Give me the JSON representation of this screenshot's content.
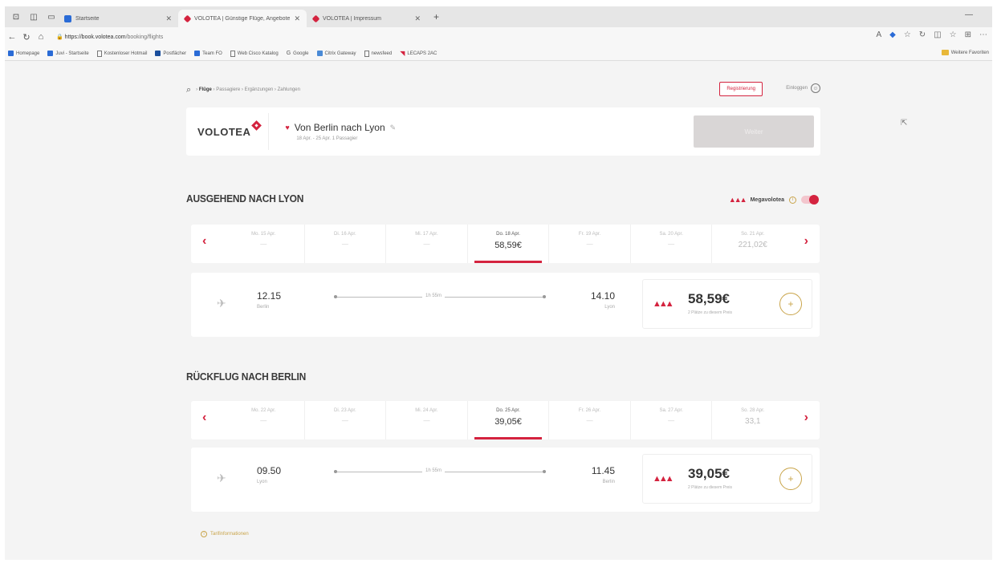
{
  "browser": {
    "tabs": [
      {
        "title": "Startseite",
        "active": false
      },
      {
        "title": "VOLOTEA | Günstige Flüge, Angebote",
        "active": true
      },
      {
        "title": "VOLOTEA | Impressum",
        "active": false
      }
    ],
    "url_host": "https://book.volotea.com",
    "url_path": "/booking/flights",
    "bookmarks": [
      "Homepage",
      "Juvi - Startseite",
      "Kostenloser Hotmail",
      "Postfächer",
      "Team FO",
      "Web Cisco Katalog",
      "Google",
      "Citrix Gateway",
      "newsfeed",
      "LECAPS 2AC"
    ],
    "bookmarks_more": "Weitere Favoriten"
  },
  "topnav": {
    "crumbs": [
      "Flüge",
      "Passagiere",
      "Ergänzungen",
      "Zahlungen"
    ],
    "register": "Registrierung",
    "login": "Einloggen"
  },
  "header": {
    "logo": "VOLOTEA",
    "route": "Von Berlin nach Lyon",
    "route_sub": "18 Apr. - 25 Apr. 1 Passagier",
    "continue": "Weiter"
  },
  "outbound": {
    "title": "AUSGEHEND NACH LYON",
    "megavolotea": "Megavolotea",
    "dates": [
      {
        "label": "Mo. 15 Apr.",
        "price": "—"
      },
      {
        "label": "Di. 16 Apr.",
        "price": "—"
      },
      {
        "label": "Mi. 17 Apr.",
        "price": "—"
      },
      {
        "label": "Do. 18 Apr.",
        "price": "58,59€",
        "selected": true
      },
      {
        "label": "Fr. 19 Apr.",
        "price": "—"
      },
      {
        "label": "Sa. 20 Apr.",
        "price": "—"
      },
      {
        "label": "So. 21 Apr.",
        "price": "221,02€"
      }
    ],
    "flight": {
      "dep_time": "12.15",
      "dep_city": "Berlin",
      "arr_time": "14.10",
      "arr_city": "Lyon",
      "duration": "1h 55m",
      "price": "58,59€",
      "price_note": "2 Plätze zu diesem Preis"
    }
  },
  "return": {
    "title": "RÜCKFLUG NACH BERLIN",
    "dates": [
      {
        "label": "Mo. 22 Apr.",
        "price": "—"
      },
      {
        "label": "Di. 23 Apr.",
        "price": "—"
      },
      {
        "label": "Mi. 24 Apr.",
        "price": "—"
      },
      {
        "label": "Do. 25 Apr.",
        "price": "39,05€",
        "selected": true
      },
      {
        "label": "Fr. 26 Apr.",
        "price": "—"
      },
      {
        "label": "Sa. 27 Apr.",
        "price": "—"
      },
      {
        "label": "So. 28 Apr.",
        "price": "33,1"
      }
    ],
    "flight": {
      "dep_time": "09.50",
      "dep_city": "Lyon",
      "arr_time": "11.45",
      "arr_city": "Berlin",
      "duration": "1h 55m",
      "price": "39,05€",
      "price_note": "2 Plätze zu diesem Preis"
    }
  },
  "footnote": "Tarifinformationen",
  "colors": {
    "accent": "#d4233f",
    "gold": "#c9a44a"
  }
}
